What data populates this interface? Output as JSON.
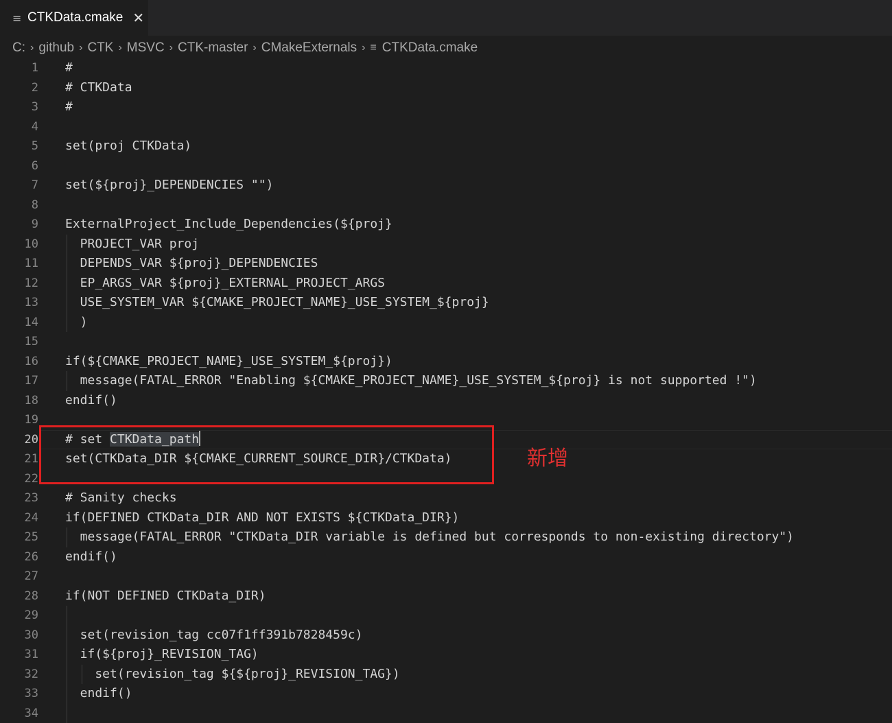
{
  "tab": {
    "label": "CTKData.cmake",
    "icon": "file-lines-icon",
    "close_icon": "close-icon"
  },
  "breadcrumb": {
    "items": [
      "C:",
      "github",
      "CTK",
      "MSVC",
      "CTK-master",
      "CMakeExternals"
    ],
    "file": "CTKData.cmake"
  },
  "editor": {
    "active_line": 20,
    "lines": [
      {
        "n": "1",
        "text": "#"
      },
      {
        "n": "2",
        "text": "# CTKData"
      },
      {
        "n": "3",
        "text": "#"
      },
      {
        "n": "4",
        "text": ""
      },
      {
        "n": "5",
        "text": "set(proj CTKData)"
      },
      {
        "n": "6",
        "text": ""
      },
      {
        "n": "7",
        "text": "set(${proj}_DEPENDENCIES \"\")"
      },
      {
        "n": "8",
        "text": ""
      },
      {
        "n": "9",
        "text": "ExternalProject_Include_Dependencies(${proj}"
      },
      {
        "n": "10",
        "text": "  PROJECT_VAR proj"
      },
      {
        "n": "11",
        "text": "  DEPENDS_VAR ${proj}_DEPENDENCIES"
      },
      {
        "n": "12",
        "text": "  EP_ARGS_VAR ${proj}_EXTERNAL_PROJECT_ARGS"
      },
      {
        "n": "13",
        "text": "  USE_SYSTEM_VAR ${CMAKE_PROJECT_NAME}_USE_SYSTEM_${proj}"
      },
      {
        "n": "14",
        "text": "  )"
      },
      {
        "n": "15",
        "text": ""
      },
      {
        "n": "16",
        "text": "if(${CMAKE_PROJECT_NAME}_USE_SYSTEM_${proj})"
      },
      {
        "n": "17",
        "text": "  message(FATAL_ERROR \"Enabling ${CMAKE_PROJECT_NAME}_USE_SYSTEM_${proj} is not supported !\")"
      },
      {
        "n": "18",
        "text": "endif()"
      },
      {
        "n": "19",
        "text": ""
      },
      {
        "n": "20",
        "text_prefix": "# set ",
        "text_highlight": "CTKData_path"
      },
      {
        "n": "21",
        "text": "set(CTKData_DIR ${CMAKE_CURRENT_SOURCE_DIR}/CTKData)"
      },
      {
        "n": "22",
        "text": ""
      },
      {
        "n": "23",
        "text": "# Sanity checks"
      },
      {
        "n": "24",
        "text": "if(DEFINED CTKData_DIR AND NOT EXISTS ${CTKData_DIR})"
      },
      {
        "n": "25",
        "text": "  message(FATAL_ERROR \"CTKData_DIR variable is defined but corresponds to non-existing directory\")"
      },
      {
        "n": "26",
        "text": "endif()"
      },
      {
        "n": "27",
        "text": ""
      },
      {
        "n": "28",
        "text": "if(NOT DEFINED CTKData_DIR)"
      },
      {
        "n": "29",
        "text": ""
      },
      {
        "n": "30",
        "text": "  set(revision_tag cc07f1ff391b7828459c)"
      },
      {
        "n": "31",
        "text": "  if(${proj}_REVISION_TAG)"
      },
      {
        "n": "32",
        "text": "    set(revision_tag ${${proj}_REVISION_TAG})"
      },
      {
        "n": "33",
        "text": "  endif()"
      },
      {
        "n": "34",
        "text": ""
      }
    ]
  },
  "annotation": {
    "label": "新增",
    "color": "#e02020"
  }
}
